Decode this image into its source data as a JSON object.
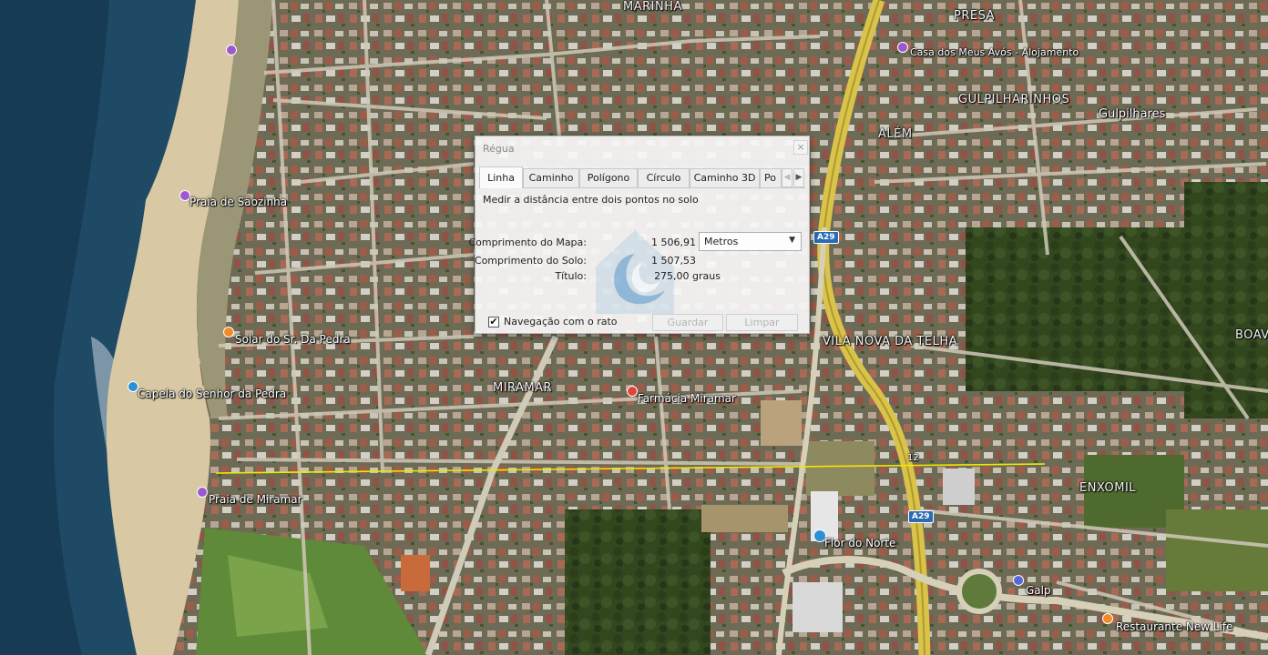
{
  "map": {
    "labels": {
      "marinha": "MARINHA",
      "presa": "PRESA",
      "casa_avos": "Casa dos Meus Avós - Alojamento",
      "gulpilharinhos": "GULPILHARINHOS",
      "gulpilhares": "Gulpilhares",
      "alem": "ALÉM",
      "praia_sao_paio": "Praia de Sãozinha",
      "vila_nova_telha": "VILA NOVA DA TELHA",
      "boav": "BOAV",
      "solar": "Solar do Sr. Da Pedra",
      "capela": "Capela do Senhor da Pedra",
      "miramar": "MIRAMAR",
      "farmacia": "Farmácia Miramar",
      "praia_miramar": "Praia de Miramar",
      "enxomil": "ENXOMIL",
      "flor_norte": "Flor do Norte",
      "galp": "Galp",
      "restaurante": "Restaurante New Life"
    },
    "shields": {
      "a29_top": "A29",
      "a29_bottom": "A29"
    },
    "ruler_marker": "12",
    "colors": {
      "ruler_line": "#f2e600",
      "water": "#1f4a66",
      "sand": "#d8c8a4",
      "highway": "#d9c34a"
    }
  },
  "ruler": {
    "title": "Régua",
    "close": "×",
    "tabs": [
      "Linha",
      "Caminho",
      "Polígono",
      "Círculo",
      "Caminho 3D",
      "Po"
    ],
    "tab_scroll_left": "◀",
    "tab_scroll_right": "▶",
    "description": "Medir a distância entre dois pontos no solo",
    "map_length_label": "Comprimento do Mapa:",
    "map_length_value": "1 506,91",
    "unit": "Metros",
    "ground_length_label": "Comprimento do Solo:",
    "ground_length_value": "1 507,53",
    "heading_label": "Título:",
    "heading_value": "275,00 graus",
    "mouse_nav_checked": "✔",
    "mouse_nav_label": "Navegação com o rato",
    "save_label": "Guardar",
    "clear_label": "Limpar"
  }
}
